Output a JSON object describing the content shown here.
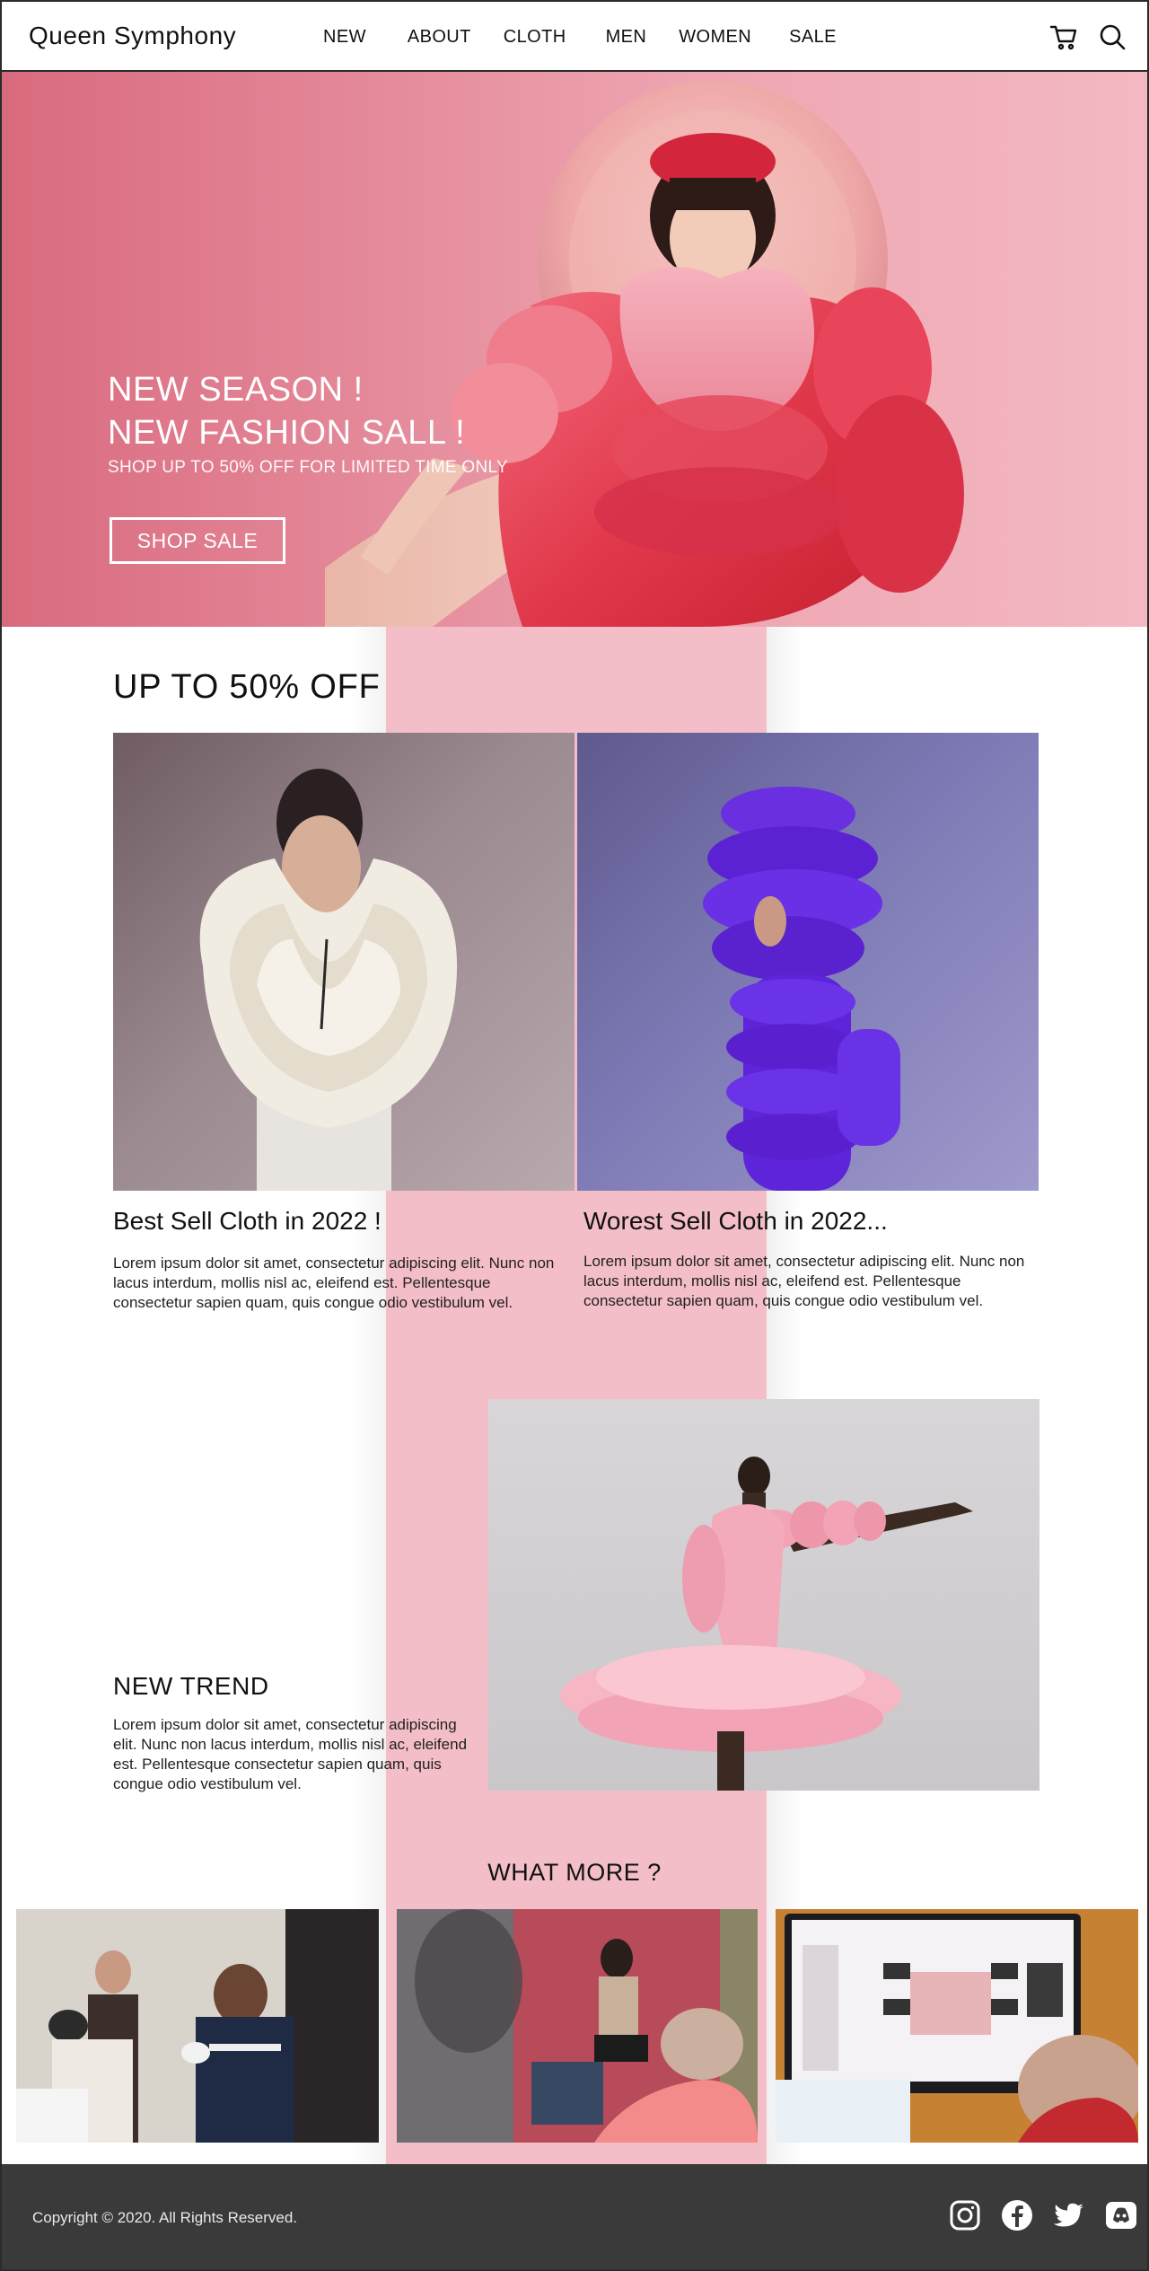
{
  "brand": {
    "logo": "Queen Symphony"
  },
  "nav": {
    "items": [
      {
        "label": "NEW"
      },
      {
        "label": "ABOUT"
      },
      {
        "label": "CLOTH"
      },
      {
        "label": "MEN"
      },
      {
        "label": "WOMEN"
      },
      {
        "label": "SALE"
      }
    ]
  },
  "header_icons": [
    "cart-icon",
    "search-icon"
  ],
  "hero": {
    "title_line1": "NEW SEASON !",
    "title_line2": "NEW FASHION SALL !",
    "subtitle": "SHOP UP TO  50% OFF FOR LIMITED TIME ONLY",
    "button_label": "SHOP SALE"
  },
  "offer": {
    "title": "UP TO 50% OFF",
    "cards": [
      {
        "title": "Best Sell Cloth in 2022 !",
        "body": "Lorem ipsum dolor sit amet, consectetur adipiscing elit. Nunc non lacus interdum, mollis nisl ac, eleifend est. Pellentesque consectetur sapien quam, quis congue odio vestibulum vel."
      },
      {
        "title": "Worest Sell Cloth in 2022...",
        "body": "Lorem ipsum dolor sit amet, consectetur adipiscing elit. Nunc non lacus interdum, mollis nisl ac, eleifend est. Pellentesque consectetur sapien quam, quis congue odio vestibulum vel."
      }
    ]
  },
  "trend": {
    "title": "NEW  TREND",
    "body": "Lorem ipsum dolor sit amet, consectetur adipiscing elit. Nunc non lacus interdum, mollis nisl ac, eleifend est. Pellentesque consectetur sapien quam, quis congue odio vestibulum vel."
  },
  "more": {
    "title": "WHAT MORE ?"
  },
  "footer": {
    "copyright": "Copyright © 2020. All Rights Reserved.",
    "social": [
      "instagram-icon",
      "facebook-icon",
      "twitter-icon",
      "discord-icon"
    ]
  },
  "colors": {
    "accent_pink": "#f4bec8",
    "footer_bg": "#3a3a3a",
    "hero_gradient_start": "#d96a7e",
    "hero_gradient_end": "#f3b9c2"
  }
}
